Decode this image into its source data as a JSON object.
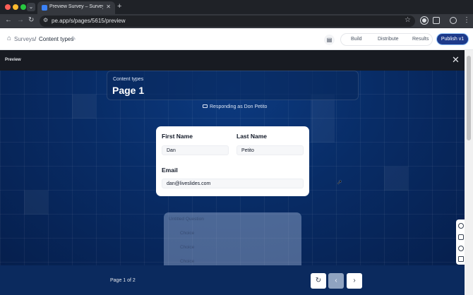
{
  "browser": {
    "tab_title": "Preview Survey – Survey Eve",
    "tab_close": "✕",
    "new_tab": "+",
    "url": "pe.app/s/pages/5615/preview",
    "icons": {
      "back": "←",
      "forward": "→",
      "reload": "↻",
      "site": "⚙",
      "star": "☆",
      "menu": "⋮",
      "tab_menu": "⌄"
    }
  },
  "header": {
    "breadcrumb_root": "Surveys",
    "breadcrumb_sep": "/",
    "breadcrumb_page": "Content types",
    "edit_icon": "✎",
    "home_icon": "⌂",
    "library_icon": "▤",
    "tabs": [
      "Build",
      "Distribute",
      "Results"
    ],
    "publish_label": "Publish v1"
  },
  "preview_bar": {
    "label": "Preview",
    "close_icon": "✕"
  },
  "page_header": {
    "kicker": "Content types",
    "title": "Page 1",
    "responding_label": "Responding as",
    "responding_name": "Don Petito"
  },
  "form": {
    "first_name_label": "First Name",
    "first_name_value": "Dan",
    "last_name_label": "Last Name",
    "last_name_value": "Petito",
    "email_label": "Email",
    "email_value": "dan@liveslides.com"
  },
  "next_question": {
    "title": "Untitled Question",
    "choices": [
      "Choice",
      "Choice",
      "Choice"
    ]
  },
  "footer": {
    "page_indicator": "Page 1 of 2",
    "restart_icon": "↻",
    "prev_icon": "‹",
    "next_icon": "›"
  },
  "colors": {
    "publish": "#1e3a8a",
    "canvas": "#082c66",
    "footer": "#0b2a5e"
  }
}
